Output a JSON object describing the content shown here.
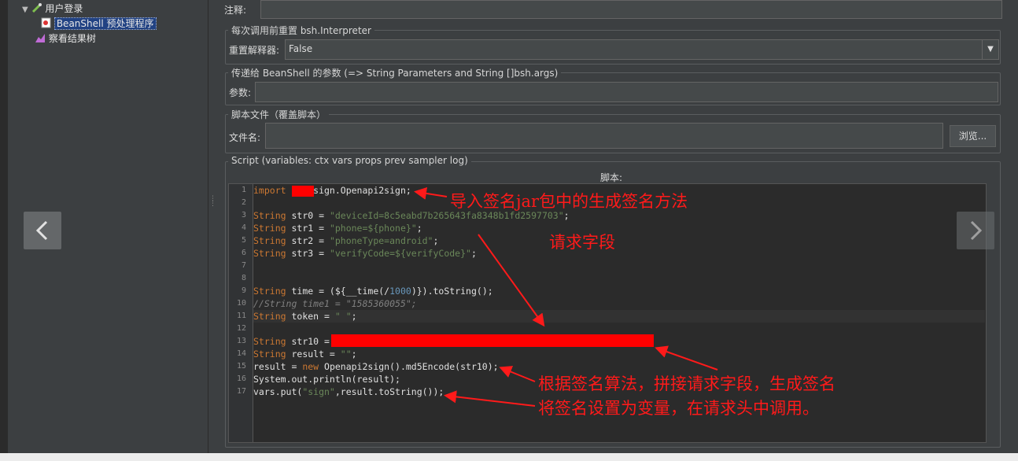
{
  "tree": {
    "item_login": "用户登录",
    "item_beanshell": "BeanShell 预处理程序",
    "item_results": "察看结果树"
  },
  "form": {
    "comment_label": "注释:",
    "reset_section": "每次调用前重置 bsh.Interpreter",
    "reset_label": "重置解释器:",
    "reset_value": "False",
    "params_section": "传递给 BeanShell 的参数 (=> String Parameters and String []bsh.args)",
    "params_label": "参数:",
    "file_section": "脚本文件（覆盖脚本）",
    "file_label": "文件名:",
    "browse_label": "浏览...",
    "script_section": "Script (variables: ctx vars props prev sampler log)",
    "script_header": "脚本:"
  },
  "annotations": {
    "a1": "导入签名jar包中的生成签名方法",
    "a2": "请求字段",
    "a3": "根据签名算法，拼接请求字段，生成签名",
    "a4": "将签名设置为变量，在请求头中调用。"
  },
  "colors": {
    "annotation": "#ff1a1a",
    "selection": "#214283",
    "keyword": "#cc7832",
    "string": "#6a8759"
  }
}
